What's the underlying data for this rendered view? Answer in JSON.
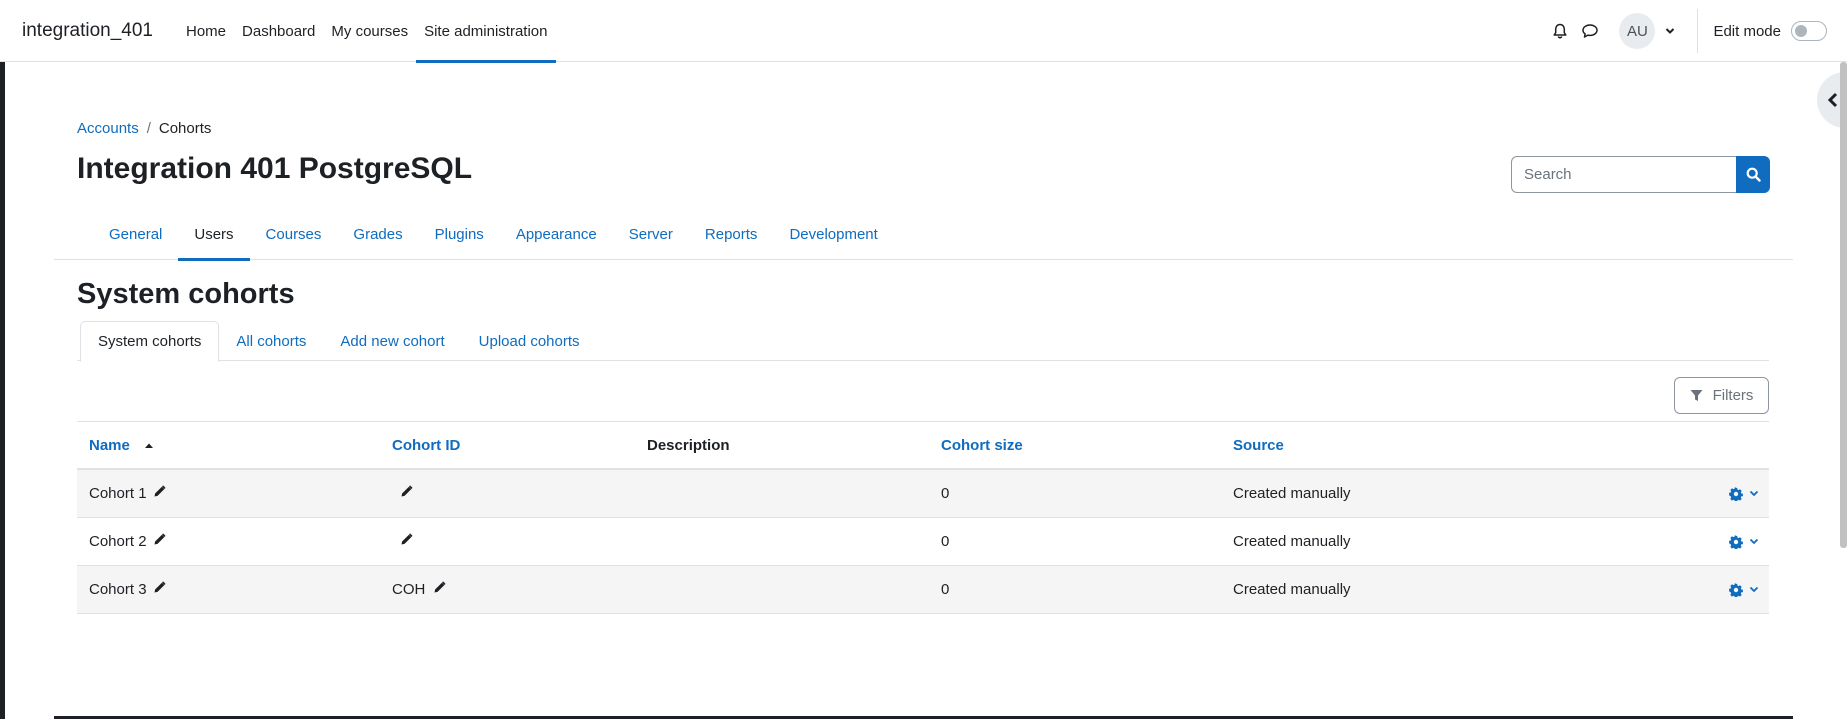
{
  "navbar": {
    "brand": "integration_401",
    "items": [
      {
        "label": "Home"
      },
      {
        "label": "Dashboard"
      },
      {
        "label": "My courses"
      },
      {
        "label": "Site administration"
      }
    ],
    "active_item": "Site administration",
    "avatar_initials": "AU",
    "edit_mode_label": "Edit mode",
    "edit_mode_on": false
  },
  "breadcrumb": {
    "items": [
      {
        "label": "Accounts"
      },
      {
        "label": "Cohorts"
      }
    ],
    "separator": "/"
  },
  "header": {
    "title": "Integration 401 PostgreSQL",
    "search_placeholder": "Search"
  },
  "secondary_nav": {
    "tabs": [
      {
        "label": "General"
      },
      {
        "label": "Users"
      },
      {
        "label": "Courses"
      },
      {
        "label": "Grades"
      },
      {
        "label": "Plugins"
      },
      {
        "label": "Appearance"
      },
      {
        "label": "Server"
      },
      {
        "label": "Reports"
      },
      {
        "label": "Development"
      }
    ],
    "active_tab": "Users"
  },
  "main": {
    "section_title": "System cohorts",
    "tabs": [
      {
        "label": "System cohorts"
      },
      {
        "label": "All cohorts"
      },
      {
        "label": "Add new cohort"
      },
      {
        "label": "Upload cohorts"
      }
    ],
    "active_tab": "System cohorts",
    "filters_label": "Filters"
  },
  "table": {
    "columns": [
      "Name",
      "Cohort ID",
      "Description",
      "Cohort size",
      "Source"
    ],
    "rows": [
      {
        "name": "Cohort 1",
        "cohort_id": "",
        "description": "",
        "size": "0",
        "source": "Created manually"
      },
      {
        "name": "Cohort 2",
        "cohort_id": "",
        "description": "",
        "size": "0",
        "source": "Created manually"
      },
      {
        "name": "Cohort 3",
        "cohort_id": "COH",
        "description": "",
        "size": "0",
        "source": "Created manually"
      }
    ]
  },
  "colors": {
    "link": "#0f6cbf",
    "text": "#1d2125",
    "row_alt": "#f5f5f5"
  }
}
